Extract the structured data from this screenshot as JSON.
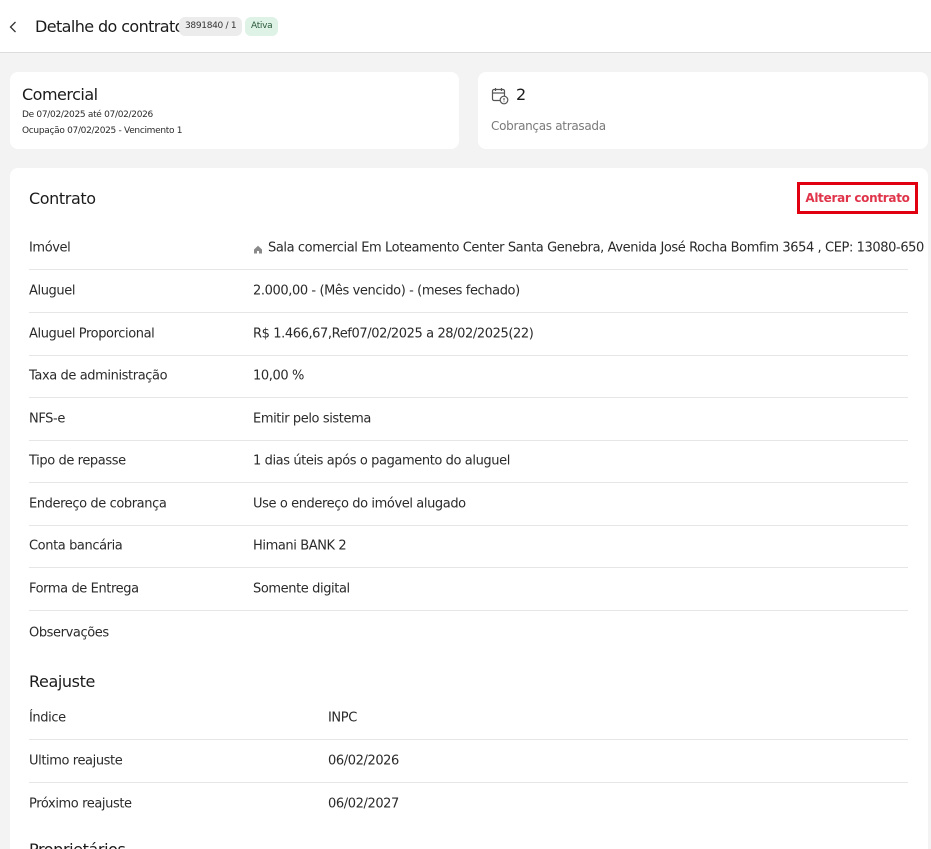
{
  "header": {
    "title": "Detalhe do contrato",
    "contract_id": "3891840 / 1",
    "status": "Ativa"
  },
  "summary": {
    "type": "Comercial",
    "period": "De 07/02/2025 até 07/02/2026",
    "occupation": "Ocupação 07/02/2025 - Vencimento 1"
  },
  "overdue": {
    "count": "2",
    "label": "Cobranças atrasada"
  },
  "contract": {
    "title": "Contrato",
    "edit_label": "Alterar contrato",
    "rows": [
      {
        "label": "Imóvel",
        "value": "Sala comercial Em Loteamento Center Santa Genebra, Avenida José Rocha Bomfim 3654 , CEP: 13080-650"
      },
      {
        "label": "Aluguel",
        "value": "2.000,00 - (Mês vencido) - (meses fechado)"
      },
      {
        "label": "Aluguel Proporcional",
        "value": "R$ 1.466,67,Ref07/02/2025 a 28/02/2025(22)"
      },
      {
        "label": "Taxa de administração",
        "value": "10,00 %"
      },
      {
        "label": "NFS-e",
        "value": "Emitir pelo sistema"
      },
      {
        "label": "Tipo de repasse",
        "value": "1 dias úteis após o pagamento do aluguel"
      },
      {
        "label": "Endereço de cobrança",
        "value": "Use o endereço do imóvel alugado"
      },
      {
        "label": "Conta bancária",
        "value": "Himani BANK 2"
      },
      {
        "label": "Forma de Entrega",
        "value": "Somente digital"
      },
      {
        "label": "Observações",
        "value": ""
      }
    ]
  },
  "reajuste": {
    "title": "Reajuste",
    "rows": [
      {
        "label": "Índice",
        "value": "INPC"
      },
      {
        "label": "Ultimo reajuste",
        "value": "06/02/2026"
      },
      {
        "label": "Próximo reajuste",
        "value": "06/02/2027"
      }
    ]
  },
  "next_section": {
    "title": "Proprietários"
  }
}
